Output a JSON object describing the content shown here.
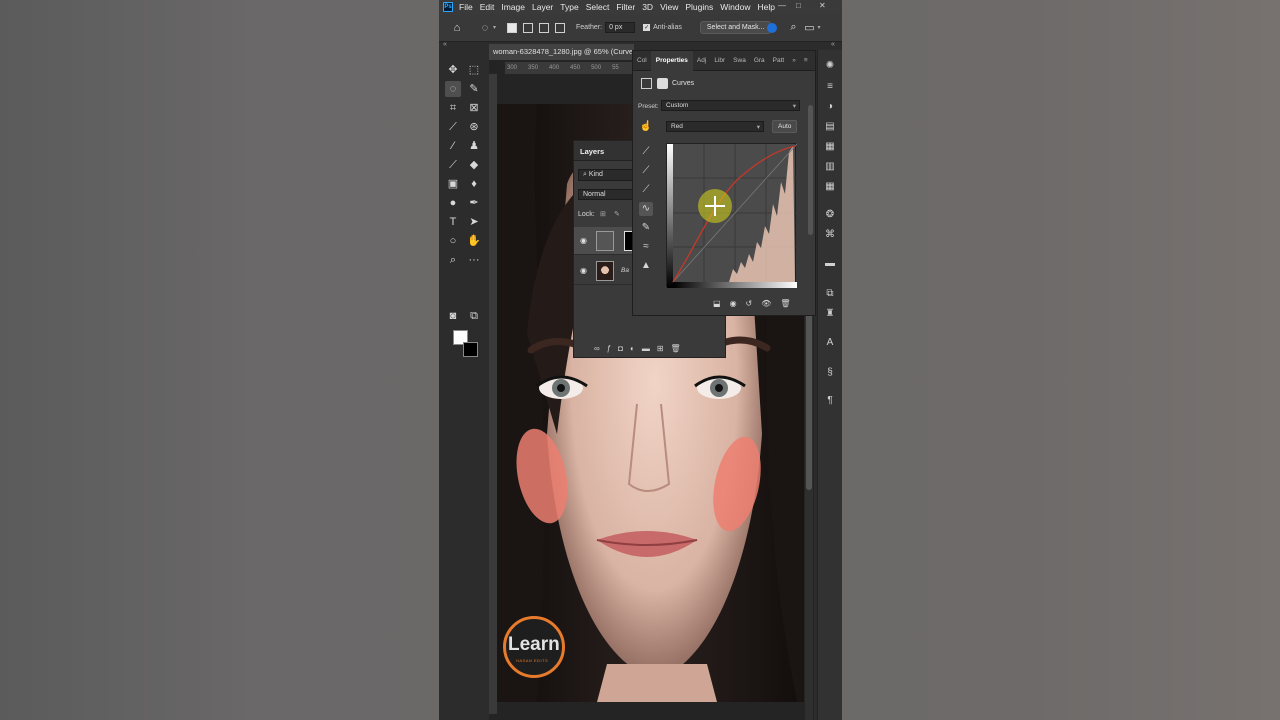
{
  "menu": [
    "File",
    "Edit",
    "Image",
    "Layer",
    "Type",
    "Select",
    "Filter",
    "3D",
    "View",
    "Plugins",
    "Window",
    "Help"
  ],
  "app_badge": "Ps",
  "options": {
    "feather_label": "Feather:",
    "feather_value": "0 px",
    "antialias_label": "Anti-alias",
    "select_mask_label": "Select and Mask..."
  },
  "document": {
    "tab_title": "woman-6328478_1280.jpg @ 65% (Curve",
    "ruler_ticks": [
      "300",
      "350",
      "400",
      "450",
      "500",
      "55"
    ]
  },
  "layers_panel": {
    "tab": "Layers",
    "filter_kind": "Kind",
    "blend_mode": "Normal",
    "lock_label": "Lock:",
    "bg_layer_label": "Ba"
  },
  "properties_panel": {
    "tabs": [
      "Col",
      "Properties",
      "Adj",
      "Libr",
      "Swa",
      "Gra",
      "Patt"
    ],
    "adjustment_name": "Curves",
    "preset_label": "Preset:",
    "preset_value": "Custom",
    "channel_value": "Red",
    "auto_button": "Auto"
  },
  "watermark": {
    "text": "Learn",
    "subtext": "HASAN EDITS"
  },
  "colors": {
    "curve_red": "#c0392b",
    "ps_blue": "#31a8ff",
    "blush": "#ec7f71"
  }
}
